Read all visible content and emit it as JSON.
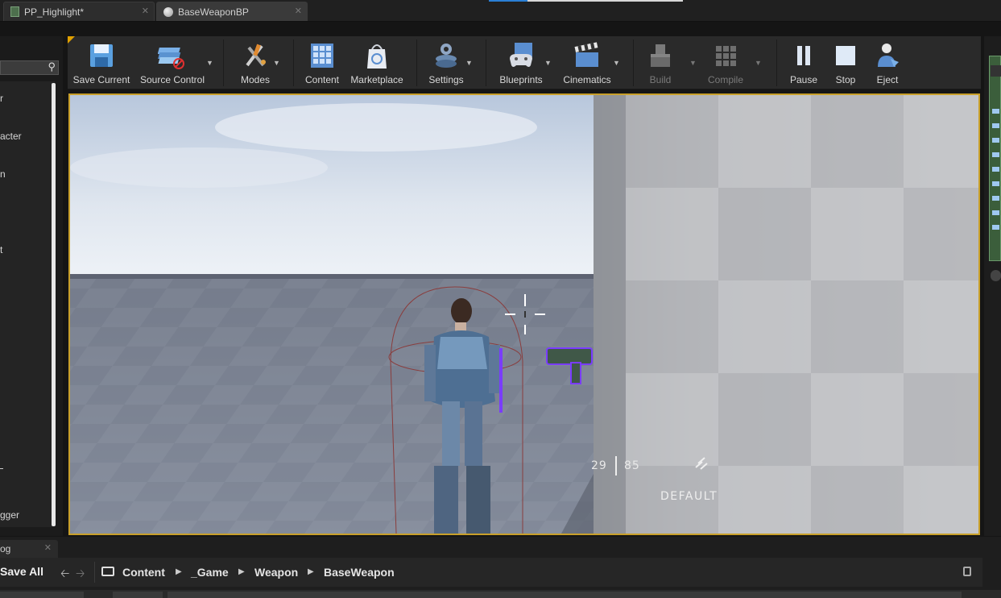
{
  "tabs": [
    {
      "label": "PP_Highlight*",
      "icon": "material-doc-icon"
    },
    {
      "label": "BaseWeaponBP",
      "icon": "blueprint-sphere-icon"
    }
  ],
  "left_panel": {
    "items": [
      "r",
      "acter",
      "n",
      "t",
      "",
      "gger"
    ]
  },
  "toolbar": {
    "buttons": [
      {
        "label": "Save Current",
        "icon": "floppy-disk-icon",
        "enabled": true
      },
      {
        "label": "Source Control",
        "icon": "source-control-icon",
        "enabled": true
      },
      {
        "label": "Modes",
        "icon": "modes-tools-icon",
        "enabled": true
      },
      {
        "label": "Content",
        "icon": "content-grid-icon",
        "enabled": true
      },
      {
        "label": "Marketplace",
        "icon": "marketplace-bag-icon",
        "enabled": true
      },
      {
        "label": "Settings",
        "icon": "settings-gears-icon",
        "enabled": true
      },
      {
        "label": "Blueprints",
        "icon": "blueprints-gamepad-icon",
        "enabled": true
      },
      {
        "label": "Cinematics",
        "icon": "clapperboard-icon",
        "enabled": true
      },
      {
        "label": "Build",
        "icon": "build-blocks-icon",
        "enabled": false
      },
      {
        "label": "Compile",
        "icon": "compile-cube-icon",
        "enabled": false
      },
      {
        "label": "Pause",
        "icon": "pause-icon",
        "enabled": true
      },
      {
        "label": "Stop",
        "icon": "stop-icon",
        "enabled": true
      },
      {
        "label": "Eject",
        "icon": "eject-person-icon",
        "enabled": true
      }
    ]
  },
  "viewport": {
    "hud": {
      "ammo_in_clip": "29",
      "ammo_reserve": "85",
      "fire_mode": "DEFAULT"
    },
    "selection_color": "#c9a02a",
    "outline_color": "#7a3cff"
  },
  "content_browser": {
    "log_tab": "og",
    "save_all": "Save All",
    "breadcrumbs": [
      "Content",
      "_Game",
      "Weapon",
      "BaseWeapon"
    ]
  }
}
